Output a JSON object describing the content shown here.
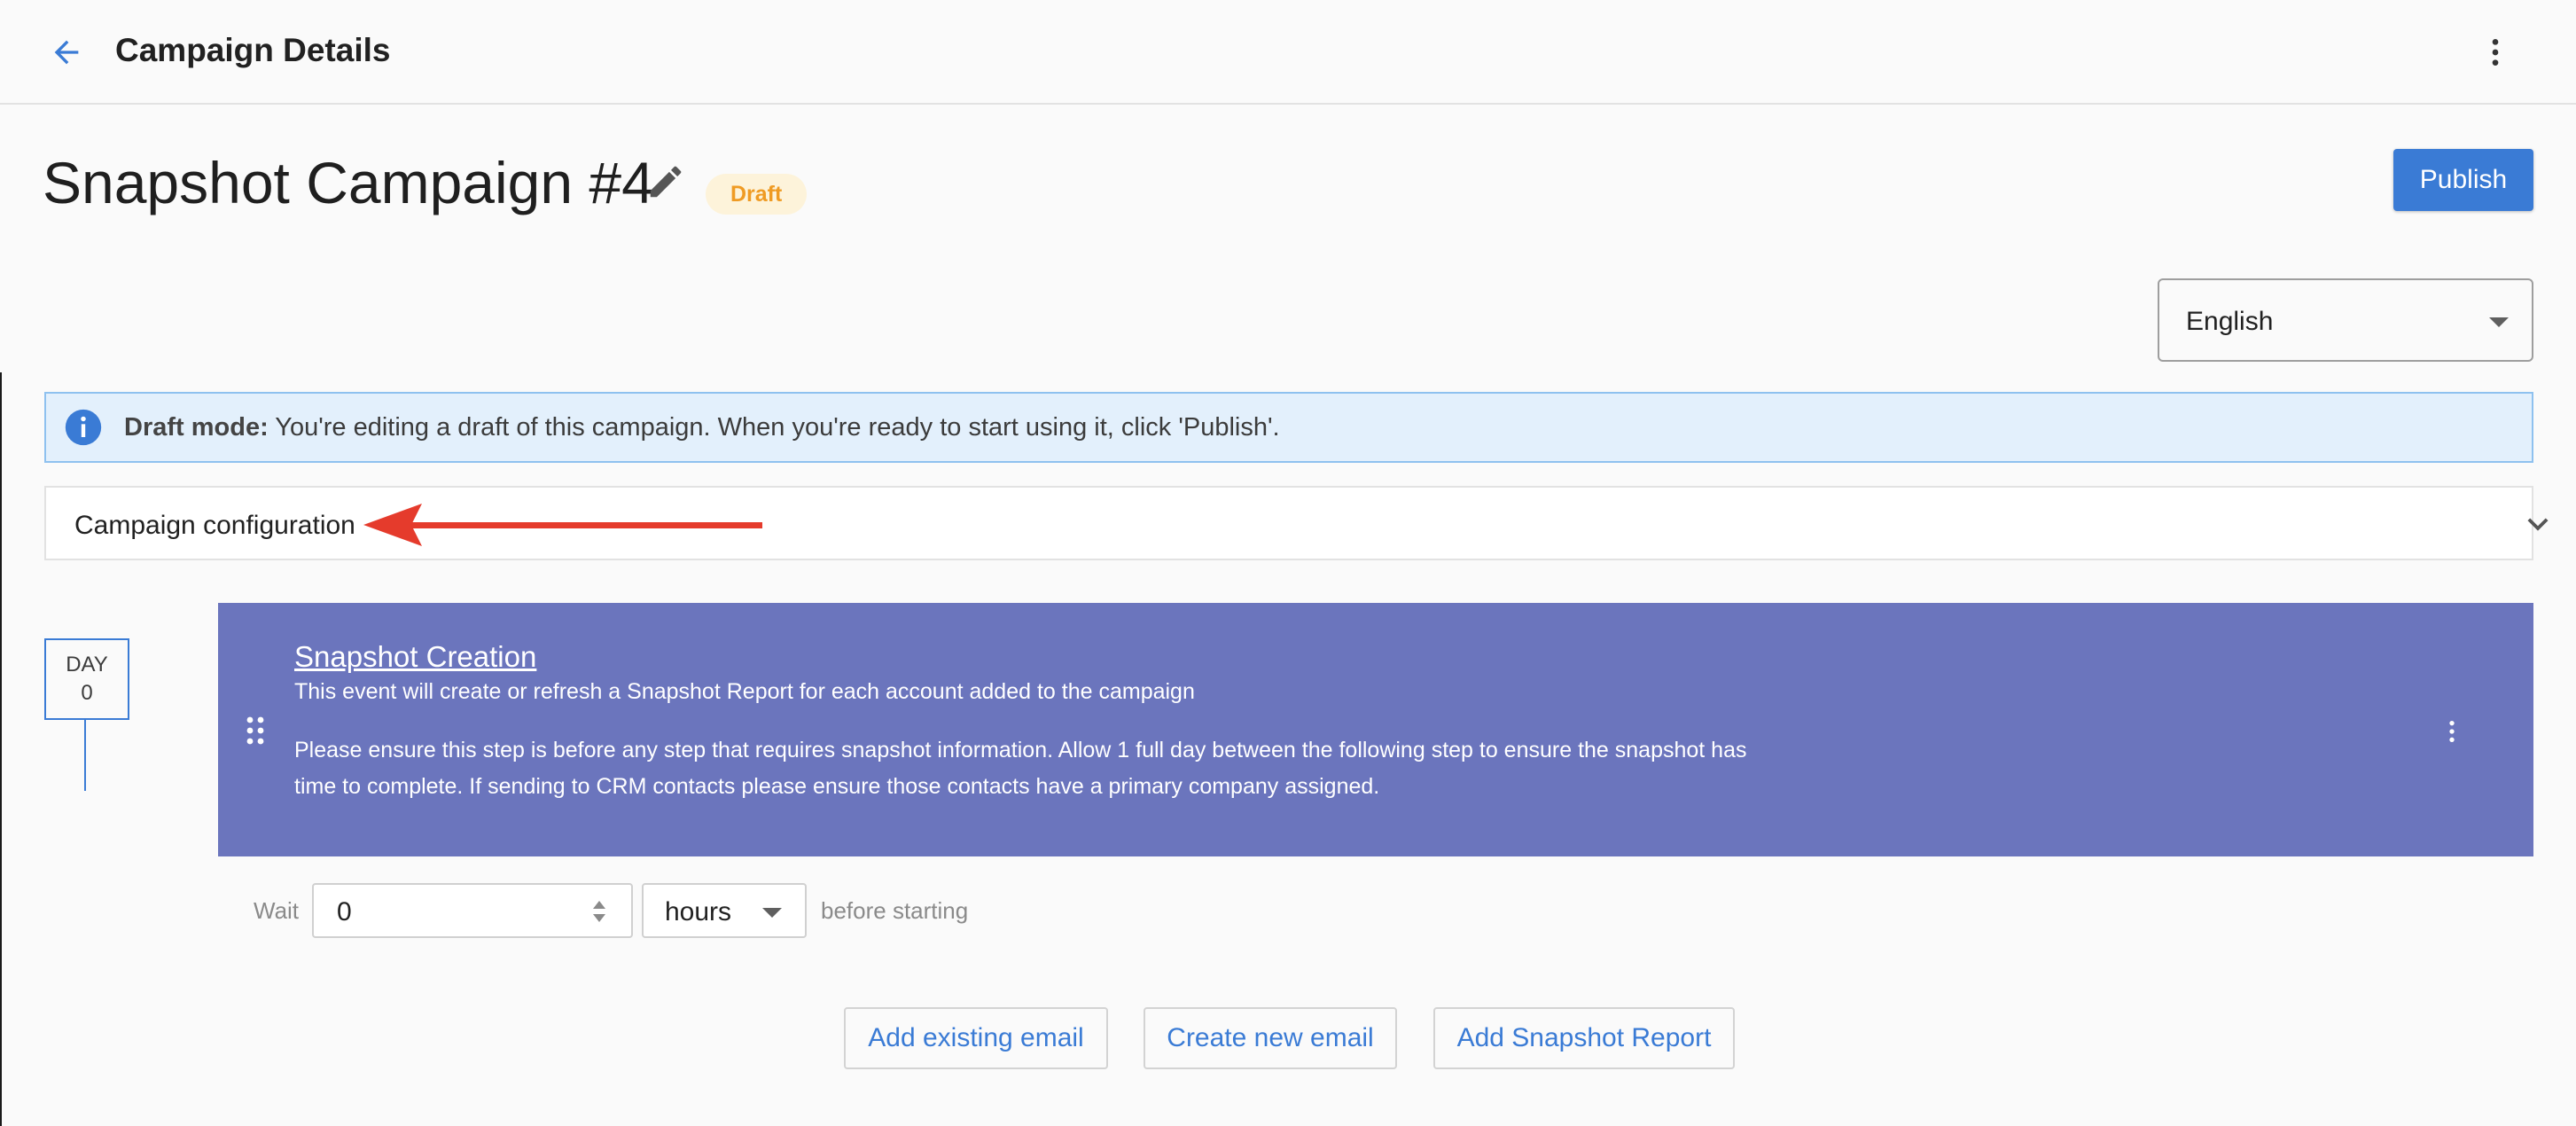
{
  "appbar": {
    "title": "Campaign Details"
  },
  "header": {
    "title": "Snapshot Campaign #4",
    "status_badge": "Draft",
    "publish_label": "Publish"
  },
  "language_select": {
    "value": "English"
  },
  "banner": {
    "prefix": "Draft mode:",
    "text": " You're editing a draft of this campaign. When you're ready to start using it, click 'Publish'."
  },
  "config": {
    "label": "Campaign configuration"
  },
  "day": {
    "label": "DAY",
    "number": "0"
  },
  "event": {
    "title": "Snapshot Creation",
    "subtitle": "This event will create or refresh a Snapshot Report for each account added to the campaign",
    "note": "Please ensure this step is before any step that requires snapshot information. Allow 1 full day between the following step to ensure the snapshot has time to complete. If sending to CRM contacts please ensure those contacts have a primary company assigned."
  },
  "wait": {
    "label": "Wait",
    "value": "0",
    "unit": "hours",
    "suffix": "before starting"
  },
  "actions": {
    "add_existing": "Add existing email",
    "create_new": "Create new email",
    "add_report": "Add Snapshot Report"
  },
  "colors": {
    "primary": "#3a7bd5",
    "event_card": "#6b75bd",
    "banner_bg": "#e3f0fc",
    "draft_badge_bg": "#fdf3da",
    "draft_badge_text": "#ef9b24",
    "annotation_arrow": "#e53b2c"
  },
  "icons": {
    "back": "arrow-left-icon",
    "menu": "more-vertical-icon",
    "edit": "pencil-icon",
    "info": "info-icon",
    "expand": "chevron-down-icon",
    "drag": "drag-handle-icon"
  }
}
